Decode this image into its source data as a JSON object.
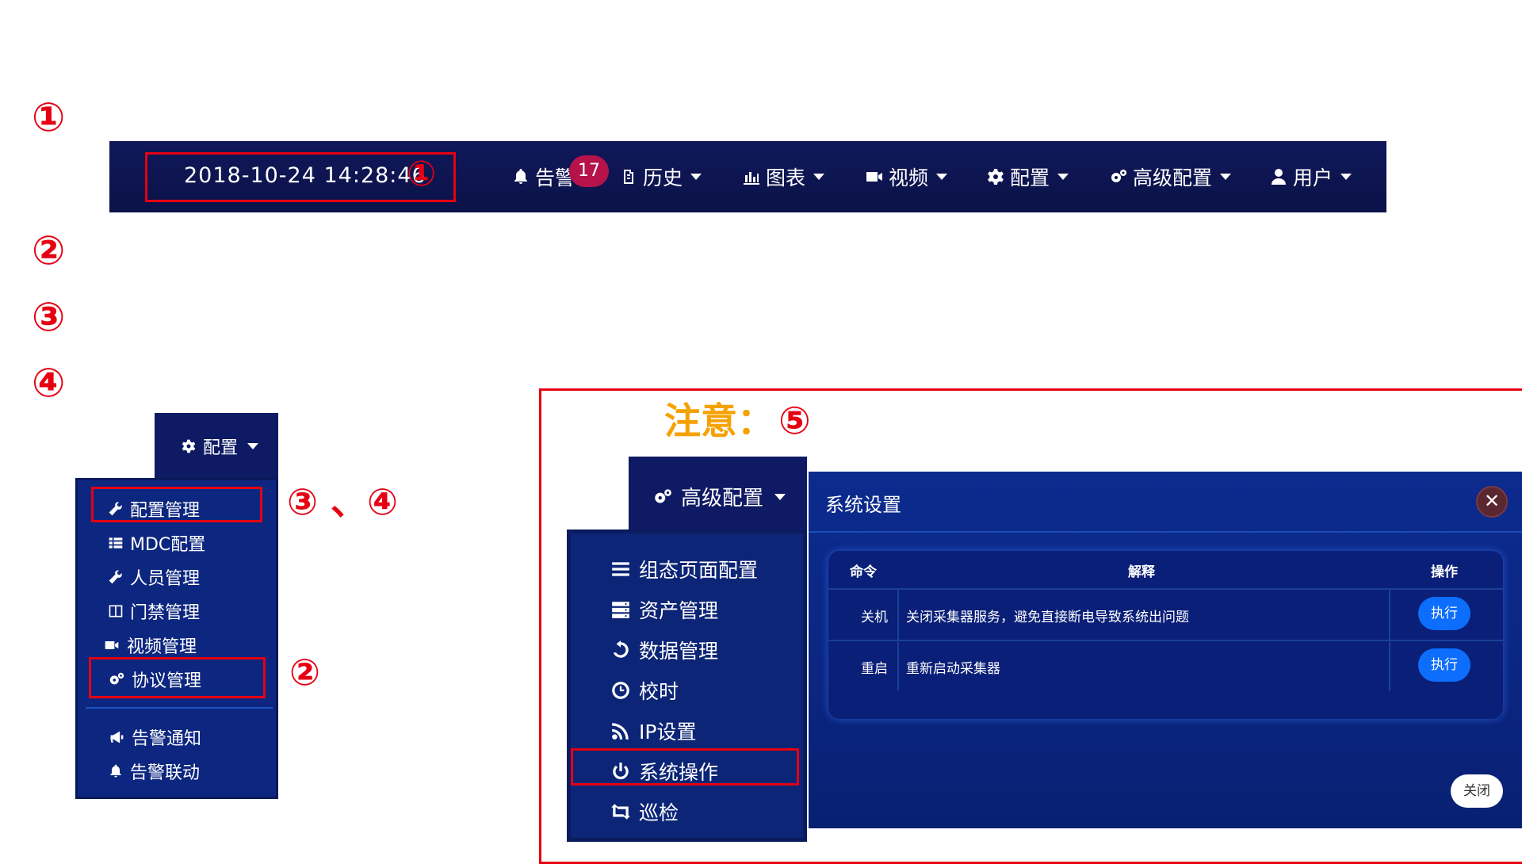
{
  "top_heading": "",
  "steps": [
    {
      "marker": "①",
      "text": ""
    },
    {
      "marker": "②",
      "text": ""
    },
    {
      "marker": "③",
      "text": ""
    },
    {
      "marker": "④",
      "text": ""
    }
  ],
  "topbar": {
    "datetime": "2018-10-24 14:28:46",
    "marker": "①",
    "alert_label": "告警",
    "alert_count": "17",
    "nav": [
      {
        "label": "历史",
        "icon": "history-icon"
      },
      {
        "label": "图表",
        "icon": "bar-chart-icon"
      },
      {
        "label": "视频",
        "icon": "video-icon"
      },
      {
        "label": "配置",
        "icon": "gear-icon"
      },
      {
        "label": "高级配置",
        "icon": "gears-icon"
      },
      {
        "label": "用户",
        "icon": "user-icon"
      }
    ]
  },
  "config_menu": {
    "tab_label": "配置",
    "items": [
      {
        "label": "配置管理",
        "icon": "wrench-icon"
      },
      {
        "label": "MDC配置",
        "icon": "list-icon"
      },
      {
        "label": "人员管理",
        "icon": "wrench-icon"
      },
      {
        "label": "门禁管理",
        "icon": "door-icon"
      },
      {
        "label": "视频管理",
        "icon": "video-icon"
      },
      {
        "label": "协议管理",
        "icon": "gears-icon"
      },
      {
        "label": "告警通知",
        "icon": "megaphone-icon"
      },
      {
        "label": "告警联动",
        "icon": "bell-icon"
      }
    ],
    "marker_34": "③ 、④",
    "marker_2": "②"
  },
  "notice": {
    "label": "注意：",
    "marker": "⑤",
    "text": ""
  },
  "advanced_menu": {
    "tab_label": "高级配置",
    "items": [
      {
        "label": "组态页面配置",
        "icon": "menu-icon"
      },
      {
        "label": "资产管理",
        "icon": "server-icon"
      },
      {
        "label": "数据管理",
        "icon": "undo-icon"
      },
      {
        "label": "校时",
        "icon": "clock-icon"
      },
      {
        "label": "IP设置",
        "icon": "rss-icon"
      },
      {
        "label": "系统操作",
        "icon": "power-icon"
      },
      {
        "label": "巡检",
        "icon": "retweet-icon"
      }
    ],
    "marker": "⑤"
  },
  "dialog": {
    "title": "系统设置",
    "close_x": "✕",
    "columns": [
      "命令",
      "解释",
      "操作"
    ],
    "rows": [
      {
        "command": "关机",
        "explanation": "关闭采集器服务，避免直接断电导致系统出问题",
        "action": "执行"
      },
      {
        "command": "重启",
        "explanation": "重新启动采集器",
        "action": "执行"
      }
    ],
    "close_button": "关闭"
  },
  "colors": {
    "annotation_red": "#e60012",
    "notice_orange": "#f5a200",
    "navbar_bg": "#0b1248",
    "menu_bg": "#0d2780",
    "button_blue": "#0d6efd"
  }
}
